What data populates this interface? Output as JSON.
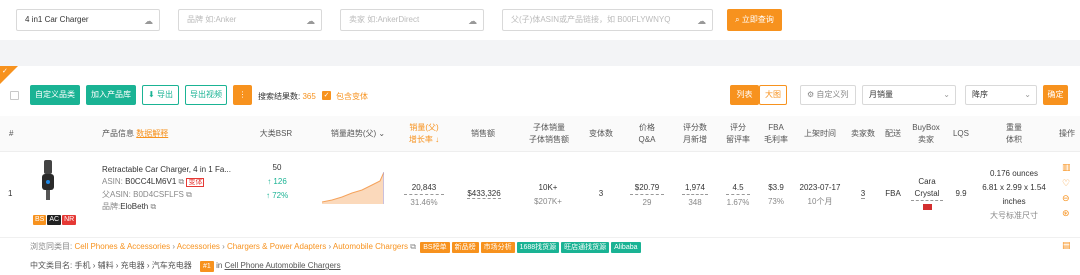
{
  "search": {
    "keyword": "4 in1 Car Charger",
    "brand_placeholder": "品牌 如:Anker",
    "seller_placeholder": "卖家 如:AnkerDirect",
    "asin_placeholder": "父(子)体ASIN或产品链接，如 B00FLYWNYQ",
    "query_button": "立即查询"
  },
  "corner_badge": "✓",
  "toolbar": {
    "custom_select": "自定义品类",
    "add_library": "加入产品库",
    "export": "导出",
    "export_video": "导出视频",
    "more": "⋮",
    "result_label": "搜索结果数:",
    "result_count": "365",
    "include_variants": "包含变体",
    "view_list": "列表",
    "view_grid": "大图",
    "custom_columns": "自定义列",
    "sort_field": "月销量",
    "sort_order": "降序",
    "confirm": "确定"
  },
  "columns": {
    "index": "#",
    "product": "产品信息",
    "product_link": "数据解释",
    "bsr": "大类BSR",
    "trend": "销量趋势(父)",
    "sales_1": "销量(父)",
    "sales_2": "增长率",
    "revenue": "销售额",
    "child_1": "子体销量",
    "child_2": "子体销售额",
    "variants": "变体数",
    "price_1": "价格",
    "price_2": "Q&A",
    "reviews_1": "评分数",
    "reviews_2": "月新增",
    "rating_1": "评分",
    "rating_2": "留评率",
    "fba_1": "FBA",
    "fba_2": "毛利率",
    "date": "上架时间",
    "sellers": "卖家数",
    "shipping": "配送",
    "buybox_1": "BuyBox",
    "buybox_2": "卖家",
    "lqs": "LQS",
    "weight_1": "重量",
    "weight_2": "体积",
    "actions": "操作"
  },
  "product": {
    "index": "1",
    "title": "Retractable Car Charger, 4 in 1 Fa...",
    "asin_label": "ASIN:",
    "asin": "B0CC4LM6V1",
    "variant_tag": "变体",
    "parent_label": "父ASIN:",
    "parent_asin": "B0D4CSFLFS",
    "brand_label": "品牌:",
    "brand": "EloBeth",
    "badges": [
      "BS",
      "AC",
      "NR"
    ],
    "bsr": "50",
    "bsr_change": "↑ 126",
    "bsr_pct": "↑ 72%",
    "sales": "20,843",
    "growth": "31.46%",
    "revenue": "$433,326",
    "child_sales": "10K+",
    "child_revenue": "$207K+",
    "variants": "3",
    "price": "$20.79",
    "qa": "29",
    "reviews": "1,974",
    "reviews_new": "348",
    "rating": "4.5",
    "review_rate": "1.67%",
    "fba": "$3.9",
    "margin": "73%",
    "date": "2023-07-17",
    "age": "10个月",
    "sellers": "3",
    "shipping": "FBA",
    "buybox": "Cara Crystal",
    "lqs": "9.9",
    "weight": "0.176 ounces",
    "dims": "6.81 x 2.99 x 1.54",
    "dims_unit": "inches",
    "size_class": "大号标准尺寸"
  },
  "category": {
    "label": "浏览同类目:",
    "path": [
      "Cell Phones & Accessories",
      "Accessories",
      "Chargers & Power Adapters",
      "Automobile Chargers"
    ],
    "tags": [
      "BS榜单",
      "新品榜",
      "市场分析",
      "1688找货源",
      "旺店通找货源",
      "Alibaba"
    ],
    "cn_label": "中文类目名:",
    "cn_path": "手机 › 辅料 › 充电器 › 汽车充电器",
    "rank_badge": "#1",
    "rank_in": "in",
    "rank_cat": "Cell Phone Automobile Chargers"
  },
  "colors": {
    "accent": "#f7921e",
    "teal": "#1ab394",
    "badge_bs": "#f7921e",
    "badge_ac": "#222222",
    "badge_nr": "#e53935"
  }
}
